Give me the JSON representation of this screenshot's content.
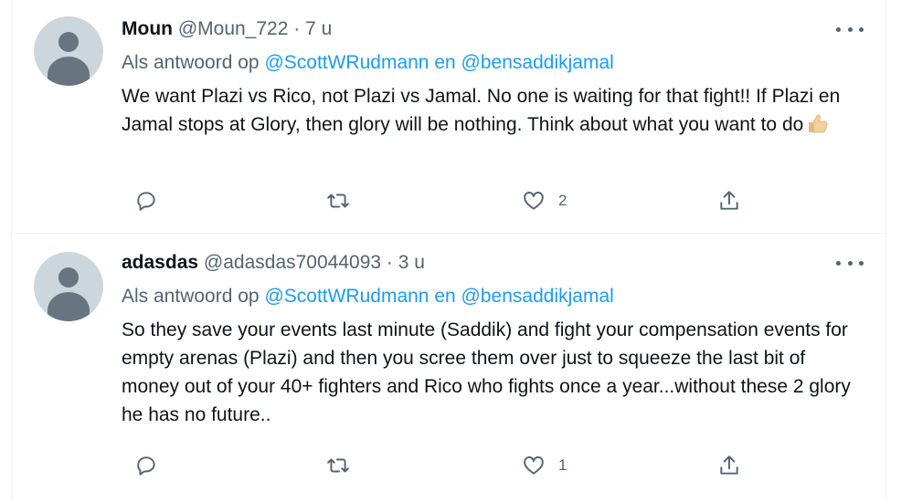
{
  "tweets": [
    {
      "name": "Moun",
      "handle": "@Moun_722",
      "separator": "·",
      "time": "7 u",
      "reply_prefix": "Als antwoord op",
      "mention_1": "@ScottWRudmann",
      "reply_joiner": "en",
      "mention_2": "@bensaddikjamal",
      "text": "We want Plazi vs Rico, not Plazi vs Jamal. No one is waiting for that fight!! If Plazi en Jamal stops at Glory, then glory will be nothing. Think about what you want to do",
      "emoji": "thumbs-up-icon",
      "reply_count": "",
      "retweet_count": "",
      "like_count": "2"
    },
    {
      "name": "adasdas",
      "handle": "@adasdas70044093",
      "separator": "·",
      "time": "3 u",
      "reply_prefix": "Als antwoord op",
      "mention_1": "@ScottWRudmann",
      "reply_joiner": "en",
      "mention_2": "@bensaddikjamal",
      "text": "So they save your events last minute (Saddik) and fight your compensation events for empty arenas (Plazi) and then you scree them over just to squeeze the last bit of money out of your 40+ fighters and Rico who fights once a year...without these 2 glory he has no future..",
      "reply_count": "",
      "retweet_count": "",
      "like_count": "1"
    }
  ],
  "colors": {
    "text": "#0f1419",
    "secondary": "#536471",
    "link": "#1d9bf0",
    "border": "#eff3f4",
    "avatar_bg": "#ccd6dd",
    "avatar_fg": "#66757f"
  }
}
